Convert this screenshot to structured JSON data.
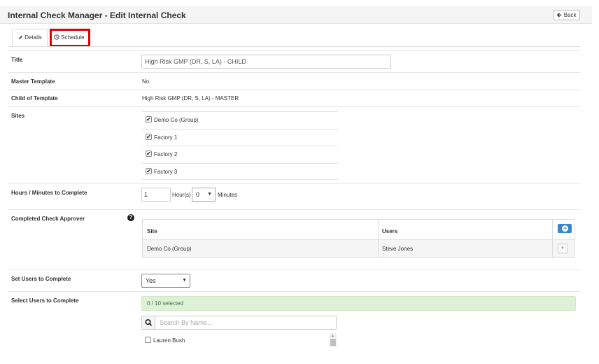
{
  "header": {
    "title": "Internal Check Manager - Edit Internal Check",
    "back_label": "Back",
    "back_icon": "arrow-left-icon"
  },
  "tabs": [
    {
      "label": "Details",
      "icon": "pencil-icon",
      "active": true
    },
    {
      "label": "Schedule",
      "icon": "clock-icon",
      "active": false,
      "highlighted": true,
      "highlight_color": "#e00000"
    }
  ],
  "form": {
    "title": {
      "label": "Title",
      "value": "High Risk GMP (DR, S, LA) - CHILD"
    },
    "master_template": {
      "label": "Master Template",
      "value": "No"
    },
    "child_of_template": {
      "label": "Child of Template",
      "value": "High Risk GMP (DR, S, LA) - MASTER"
    },
    "sites": {
      "label": "Sites",
      "items": [
        {
          "label": "Demo Co (Group)",
          "checked": true
        },
        {
          "label": "Factory 1",
          "checked": true
        },
        {
          "label": "Factory 2",
          "checked": true
        },
        {
          "label": "Factory 3",
          "checked": true
        }
      ]
    },
    "hours_minutes": {
      "label": "Hours / Minutes to Complete",
      "hours_value": "1",
      "hours_label": "Hour(s)",
      "minutes_value": "0",
      "minutes_label": "Minutes"
    },
    "approver": {
      "label": "Completed Check Approver",
      "columns": [
        "Site",
        "Users"
      ],
      "rows": [
        {
          "site": "Demo Co (Group)",
          "users": "Steve Jones"
        }
      ]
    },
    "set_users": {
      "label": "Set Users to Complete",
      "value": "Yes"
    },
    "select_users": {
      "label": "Select Users to Complete",
      "selected_text": "0 / 10 selected",
      "search_placeholder": "Search By Name...",
      "users": [
        {
          "name": "Lauren Bush",
          "checked": false
        }
      ]
    }
  },
  "colors": {
    "accent": "#3a87c8",
    "success_bg": "#dff0d8",
    "success_text": "#3c763d",
    "highlight": "#e00000"
  }
}
